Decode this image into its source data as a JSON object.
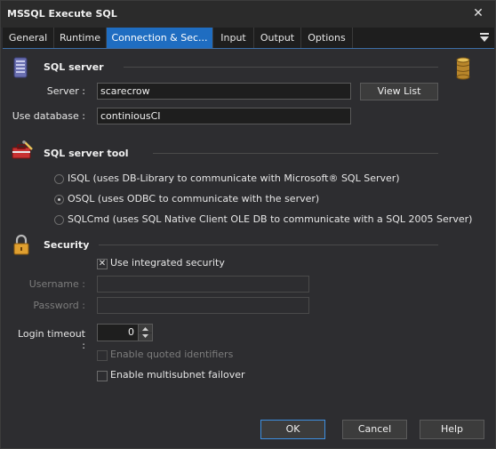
{
  "window": {
    "title": "MSSQL Execute SQL",
    "close_glyph": "✕"
  },
  "tabs": [
    {
      "label": "General"
    },
    {
      "label": "Runtime"
    },
    {
      "label": "Connection & Sec..."
    },
    {
      "label": "Input"
    },
    {
      "label": "Output"
    },
    {
      "label": "Options"
    }
  ],
  "sql_server": {
    "section_title": "SQL server",
    "server_label": "Server :",
    "server_value": "scarecrow",
    "view_list_label": "View List",
    "database_label": "Use database :",
    "database_value": "continiousCI"
  },
  "tool": {
    "section_title": "SQL server tool",
    "options": [
      {
        "label": "ISQL (uses DB-Library to communicate with Microsoft® SQL Server)"
      },
      {
        "label": "OSQL (uses ODBC to communicate with the server)"
      },
      {
        "label": "SQLCmd (uses SQL Native Client OLE DB to communicate with a SQL 2005 Server)"
      }
    ],
    "selected_index": 1
  },
  "security": {
    "section_title": "Security",
    "integrated_label": "Use integrated security",
    "integrated_checked": true,
    "username_label": "Username :",
    "username_value": "",
    "password_label": "Password :",
    "password_value": ""
  },
  "misc": {
    "login_timeout_label": "Login timeout :",
    "login_timeout_value": "0",
    "quoted_identifiers_label": "Enable quoted identifiers",
    "quoted_identifiers_checked": false,
    "multisubnet_label": "Enable multisubnet failover",
    "multisubnet_checked": false
  },
  "footer": {
    "ok_label": "OK",
    "cancel_label": "Cancel",
    "help_label": "Help"
  },
  "colors": {
    "accent": "#1f6dc1",
    "background": "#2d2d30",
    "titlebar": "#2b2b2b"
  },
  "icons": {
    "sql_server": "server-icon",
    "database": "database-cylinder-icon",
    "tool": "toolbox-icon",
    "security": "padlock-icon",
    "tab_menu": "hamburger-menu-icon"
  }
}
